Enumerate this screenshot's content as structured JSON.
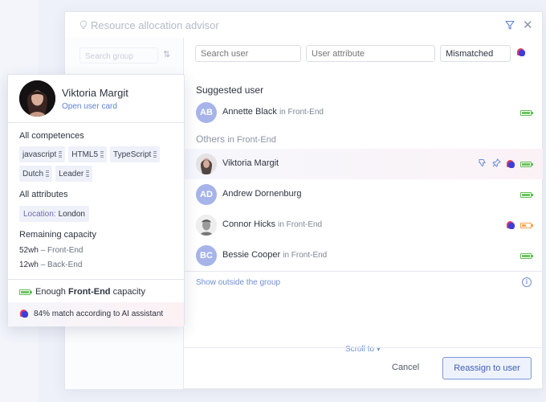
{
  "dialog": {
    "title": "Resource allocation advisor",
    "search_group_placeholder": "Search group",
    "filters": {
      "search_user_placeholder": "Search user",
      "user_attribute_placeholder": "User attribute",
      "mismatched_value": "Mismatched"
    },
    "suggested_label": "Suggested user",
    "suggested": [
      {
        "initials": "AB",
        "name": "Annette Black",
        "group": "in Front-End",
        "capacity": 1.0
      }
    ],
    "others_label": "Others",
    "others_group": "in Front-End",
    "others": [
      {
        "initials": "",
        "name": "Viktoria Margit",
        "group": "",
        "capacity": 1.0,
        "photo": true,
        "highlighted": true
      },
      {
        "initials": "AD",
        "name": "Andrew Dornenburg",
        "group": "",
        "capacity": 1.0
      },
      {
        "initials": "",
        "name": "Connor Hicks",
        "group": "in Front-End",
        "capacity": 0.5,
        "photo": true,
        "capacity_color": "#f5a04a"
      },
      {
        "initials": "BC",
        "name": "Bessie Cooper",
        "group": "in Front-End",
        "capacity": 1.0
      }
    ],
    "show_outside": "Show outside the group",
    "scroll_to": "Scroll to ▾",
    "cancel_label": "Cancel",
    "reassign_label": "Reassign to user"
  },
  "card": {
    "name": "Viktoria Margit",
    "open_link": "Open user card",
    "competences_title": "All competences",
    "competences": [
      "javascript",
      "HTML5",
      "TypeScript",
      "Dutch",
      "Leader"
    ],
    "attributes_title": "All attributes",
    "attribute": {
      "key": "Location:",
      "value": "London"
    },
    "capacity_title": "Remaining capacity",
    "capacity_lines": [
      {
        "amount": "52wh",
        "group": "– Front-End"
      },
      {
        "amount": "12wh",
        "group": "– Back-End"
      }
    ],
    "enough_prefix": "Enough ",
    "enough_bold": "Front-End",
    "enough_suffix": " capacity",
    "match_text": "84% match according to AI assistant"
  },
  "colors": {
    "accent": "#5d83d3",
    "battery_ok": "#5fbf52",
    "battery_low": "#f5a04a",
    "avatar": "#a6b4ea"
  }
}
